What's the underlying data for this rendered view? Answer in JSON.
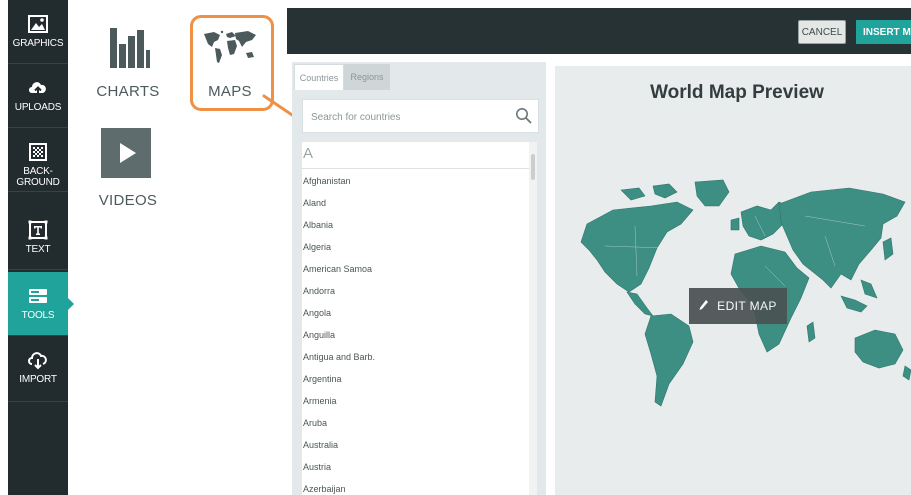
{
  "colors": {
    "accent": "#1fa39a",
    "sidebar": "#222b2d",
    "topbar": "#273234",
    "map_land": "#3d8f84",
    "annotation": "#ee9045"
  },
  "sidebar": {
    "items": [
      {
        "label": "GRAPHICS",
        "icon": "image-icon"
      },
      {
        "label": "UPLOADS",
        "icon": "cloud-upload-icon"
      },
      {
        "label": "BACK-\nGROUND",
        "icon": "background-pattern-icon"
      },
      {
        "label": "TEXT",
        "icon": "text-box-icon"
      },
      {
        "label": "TOOLS",
        "icon": "tools-icon",
        "active": true
      },
      {
        "label": "IMPORT",
        "icon": "cloud-download-icon"
      }
    ]
  },
  "tools": {
    "charts": {
      "label": "CHARTS",
      "icon": "bar-chart-icon"
    },
    "maps": {
      "label": "MAPS",
      "icon": "world-map-icon"
    },
    "videos": {
      "label": "VIDEOS",
      "icon": "play-icon"
    }
  },
  "toolbar": {
    "cancel_label": "CANCEL",
    "insert_label": "INSERT MA"
  },
  "countries_panel": {
    "tabs": [
      "Countries",
      "Regions"
    ],
    "active_tab": "Countries",
    "search": {
      "placeholder": "Search for countries",
      "value": ""
    },
    "letter": "A",
    "countries": [
      "Afghanistan",
      "Aland",
      "Albania",
      "Algeria",
      "American Samoa",
      "Andorra",
      "Angola",
      "Anguilla",
      "Antigua and Barb.",
      "Argentina",
      "Armenia",
      "Aruba",
      "Australia",
      "Austria",
      "Azerbaijan"
    ]
  },
  "preview": {
    "title": "World Map Preview",
    "edit_label": "EDIT MAP"
  }
}
